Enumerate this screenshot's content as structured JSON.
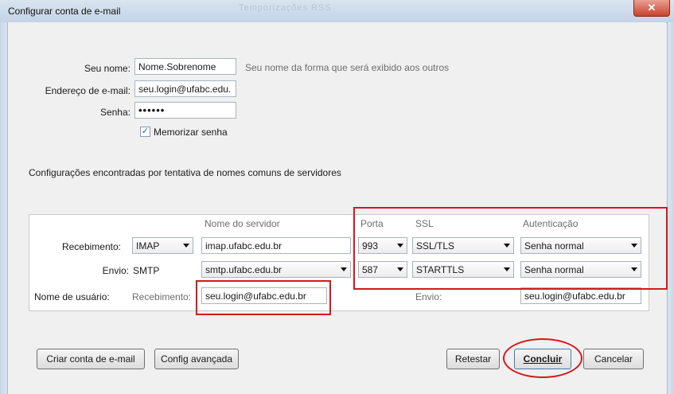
{
  "window": {
    "title": "Configurar conta de e-mail",
    "ghost_tabs": "Temporizações   RSS"
  },
  "form": {
    "name_label": "Seu nome:",
    "name_value": "Nome.Sobrenome",
    "name_hint": "Seu nome da forma que será exibido aos outros",
    "email_label": "Endereço de e-mail:",
    "email_value": "seu.login@ufabc.edu.",
    "password_label": "Senha:",
    "password_value": "••••••",
    "remember_label": "Memorizar senha",
    "remember_checked": true
  },
  "status_message": "Configurações encontradas por tentativa de nomes comuns de servidores",
  "server_table": {
    "headers": {
      "server": "Nome do servidor",
      "port": "Porta",
      "ssl": "SSL",
      "auth": "Autenticação"
    },
    "incoming": {
      "label": "Recebimento:",
      "protocol": "IMAP",
      "server": "imap.ufabc.edu.br",
      "port": "993",
      "ssl": "SSL/TLS",
      "auth": "Senha normal"
    },
    "outgoing": {
      "label": "Envio:",
      "protocol": "SMTP",
      "server": "smtp.ufabc.edu.br",
      "port": "587",
      "ssl": "STARTTLS",
      "auth": "Senha normal"
    },
    "username": {
      "label": "Nome de usuário:",
      "incoming_label": "Recebimento:",
      "incoming_value": "seu.login@ufabc.edu.br",
      "outgoing_label": "Envio:",
      "outgoing_value": "seu.login@ufabc.edu.br"
    }
  },
  "buttons": {
    "create_account": "Criar conta de e-mail",
    "advanced_config": "Config avançada",
    "retest": "Retestar",
    "done": "Concluir",
    "cancel": "Cancelar"
  },
  "annotation_color": "#d9161c"
}
